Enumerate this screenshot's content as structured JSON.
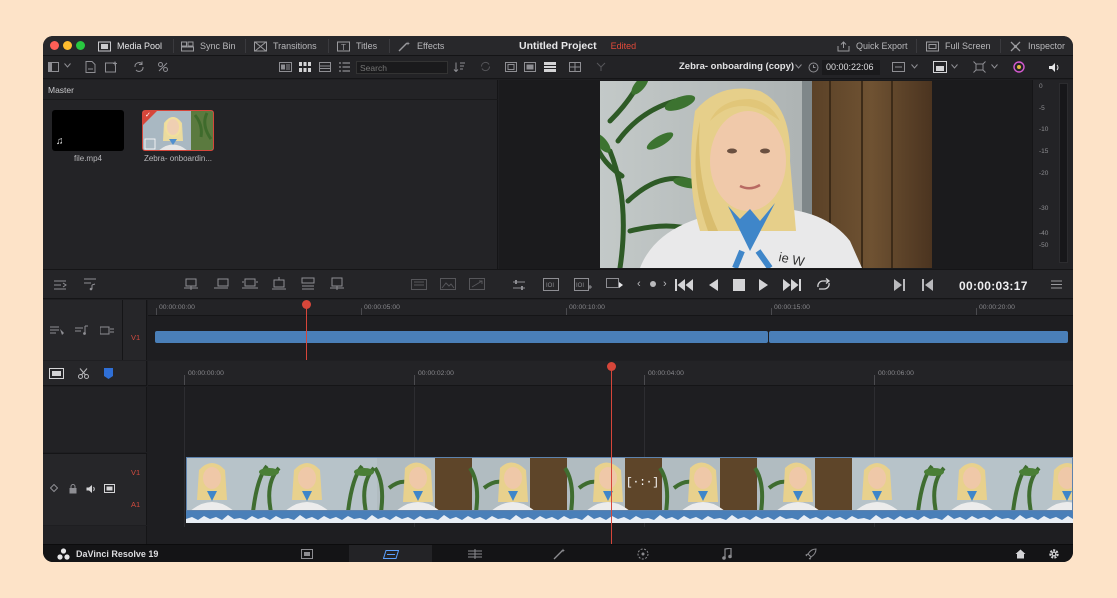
{
  "window": {
    "project_name": "Untitled Project",
    "status": "Edited",
    "traffic_lights": [
      "#ff5f57",
      "#febc2e",
      "#28c840"
    ]
  },
  "top_tabs": {
    "media_pool": "Media Pool",
    "sync_bin": "Sync Bin",
    "transitions": "Transitions",
    "titles": "Titles",
    "effects": "Effects",
    "quick_export": "Quick Export",
    "full_screen": "Full Screen",
    "inspector": "Inspector"
  },
  "media_pool": {
    "search_placeholder": "Search",
    "bin_name": "Master",
    "clips": [
      {
        "name": "file.mp4",
        "icon": "music-note-icon"
      },
      {
        "name": "Zebra- onboardin...",
        "icon": "video-clip-icon"
      }
    ]
  },
  "viewer": {
    "clip_name": "Zebra- onboarding (copy)",
    "duration_timecode": "00:00:22:06",
    "current_timecode": "00:00:03:17"
  },
  "audio_meter": {
    "labels": [
      "0",
      "-5",
      "-10",
      "-15",
      "-20",
      "-30",
      "-40",
      "-50"
    ]
  },
  "upper_timeline": {
    "ruler": [
      "00:00:00:00",
      "00:00:05:00",
      "00:00:10:00",
      "00:00:15:00",
      "00:00:20:00"
    ],
    "track_label": "V1"
  },
  "lower_timeline": {
    "ruler": [
      "00:00:00:00",
      "00:00:02:00",
      "00:00:04:00",
      "00:00:06:00"
    ],
    "video_track": "V1",
    "audio_track": "A1",
    "trim_indicator": "[·:·]"
  },
  "footer": {
    "app_name": "DaVinci Resolve 19",
    "pages": [
      "media",
      "cut",
      "edit",
      "fusion",
      "color",
      "fairlight",
      "deliver"
    ]
  },
  "colors": {
    "accent_red": "#d6463a",
    "clip_blue": "#4a7fb8",
    "panel": "#232326"
  }
}
